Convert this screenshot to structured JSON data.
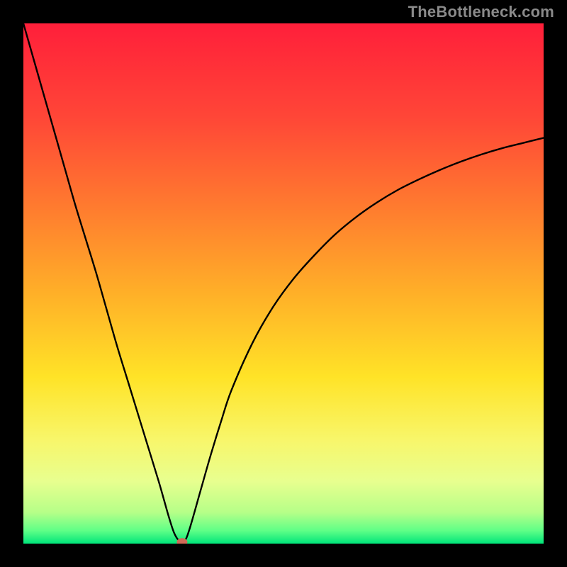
{
  "watermark": "TheBottleneck.com",
  "colors": {
    "frame": "#000000",
    "curve": "#000000",
    "dot": "#cf6a57",
    "gradient_stops": [
      {
        "offset": 0.0,
        "color": "#ff1f3a"
      },
      {
        "offset": 0.18,
        "color": "#ff4637"
      },
      {
        "offset": 0.35,
        "color": "#ff7a2f"
      },
      {
        "offset": 0.52,
        "color": "#ffb028"
      },
      {
        "offset": 0.68,
        "color": "#ffe327"
      },
      {
        "offset": 0.8,
        "color": "#f8f66a"
      },
      {
        "offset": 0.88,
        "color": "#e8ff8f"
      },
      {
        "offset": 0.94,
        "color": "#b6ff88"
      },
      {
        "offset": 0.975,
        "color": "#5fff87"
      },
      {
        "offset": 1.0,
        "color": "#00e57a"
      }
    ]
  },
  "chart_data": {
    "type": "line",
    "title": "",
    "xlabel": "",
    "ylabel": "",
    "xlim": [
      0,
      100
    ],
    "ylim": [
      0,
      100
    ],
    "x": [
      0,
      2,
      4,
      6,
      8,
      10,
      12,
      14,
      16,
      18,
      20,
      22,
      24,
      26,
      27,
      28,
      29,
      30,
      31,
      32,
      34,
      36,
      38,
      40,
      44,
      48,
      52,
      56,
      60,
      64,
      68,
      72,
      76,
      80,
      84,
      88,
      92,
      96,
      100
    ],
    "values": [
      100,
      93,
      86,
      79,
      72,
      65,
      58.5,
      52,
      45,
      38,
      31.5,
      25,
      18.5,
      12,
      8.5,
      5,
      2,
      0.5,
      0.5,
      3,
      10,
      17,
      23.5,
      29.5,
      38.5,
      45.5,
      51,
      55.5,
      59.5,
      62.8,
      65.6,
      68,
      70,
      71.8,
      73.4,
      74.8,
      76,
      77,
      78
    ],
    "marker": {
      "x": 30.5,
      "y": 0.3
    }
  }
}
